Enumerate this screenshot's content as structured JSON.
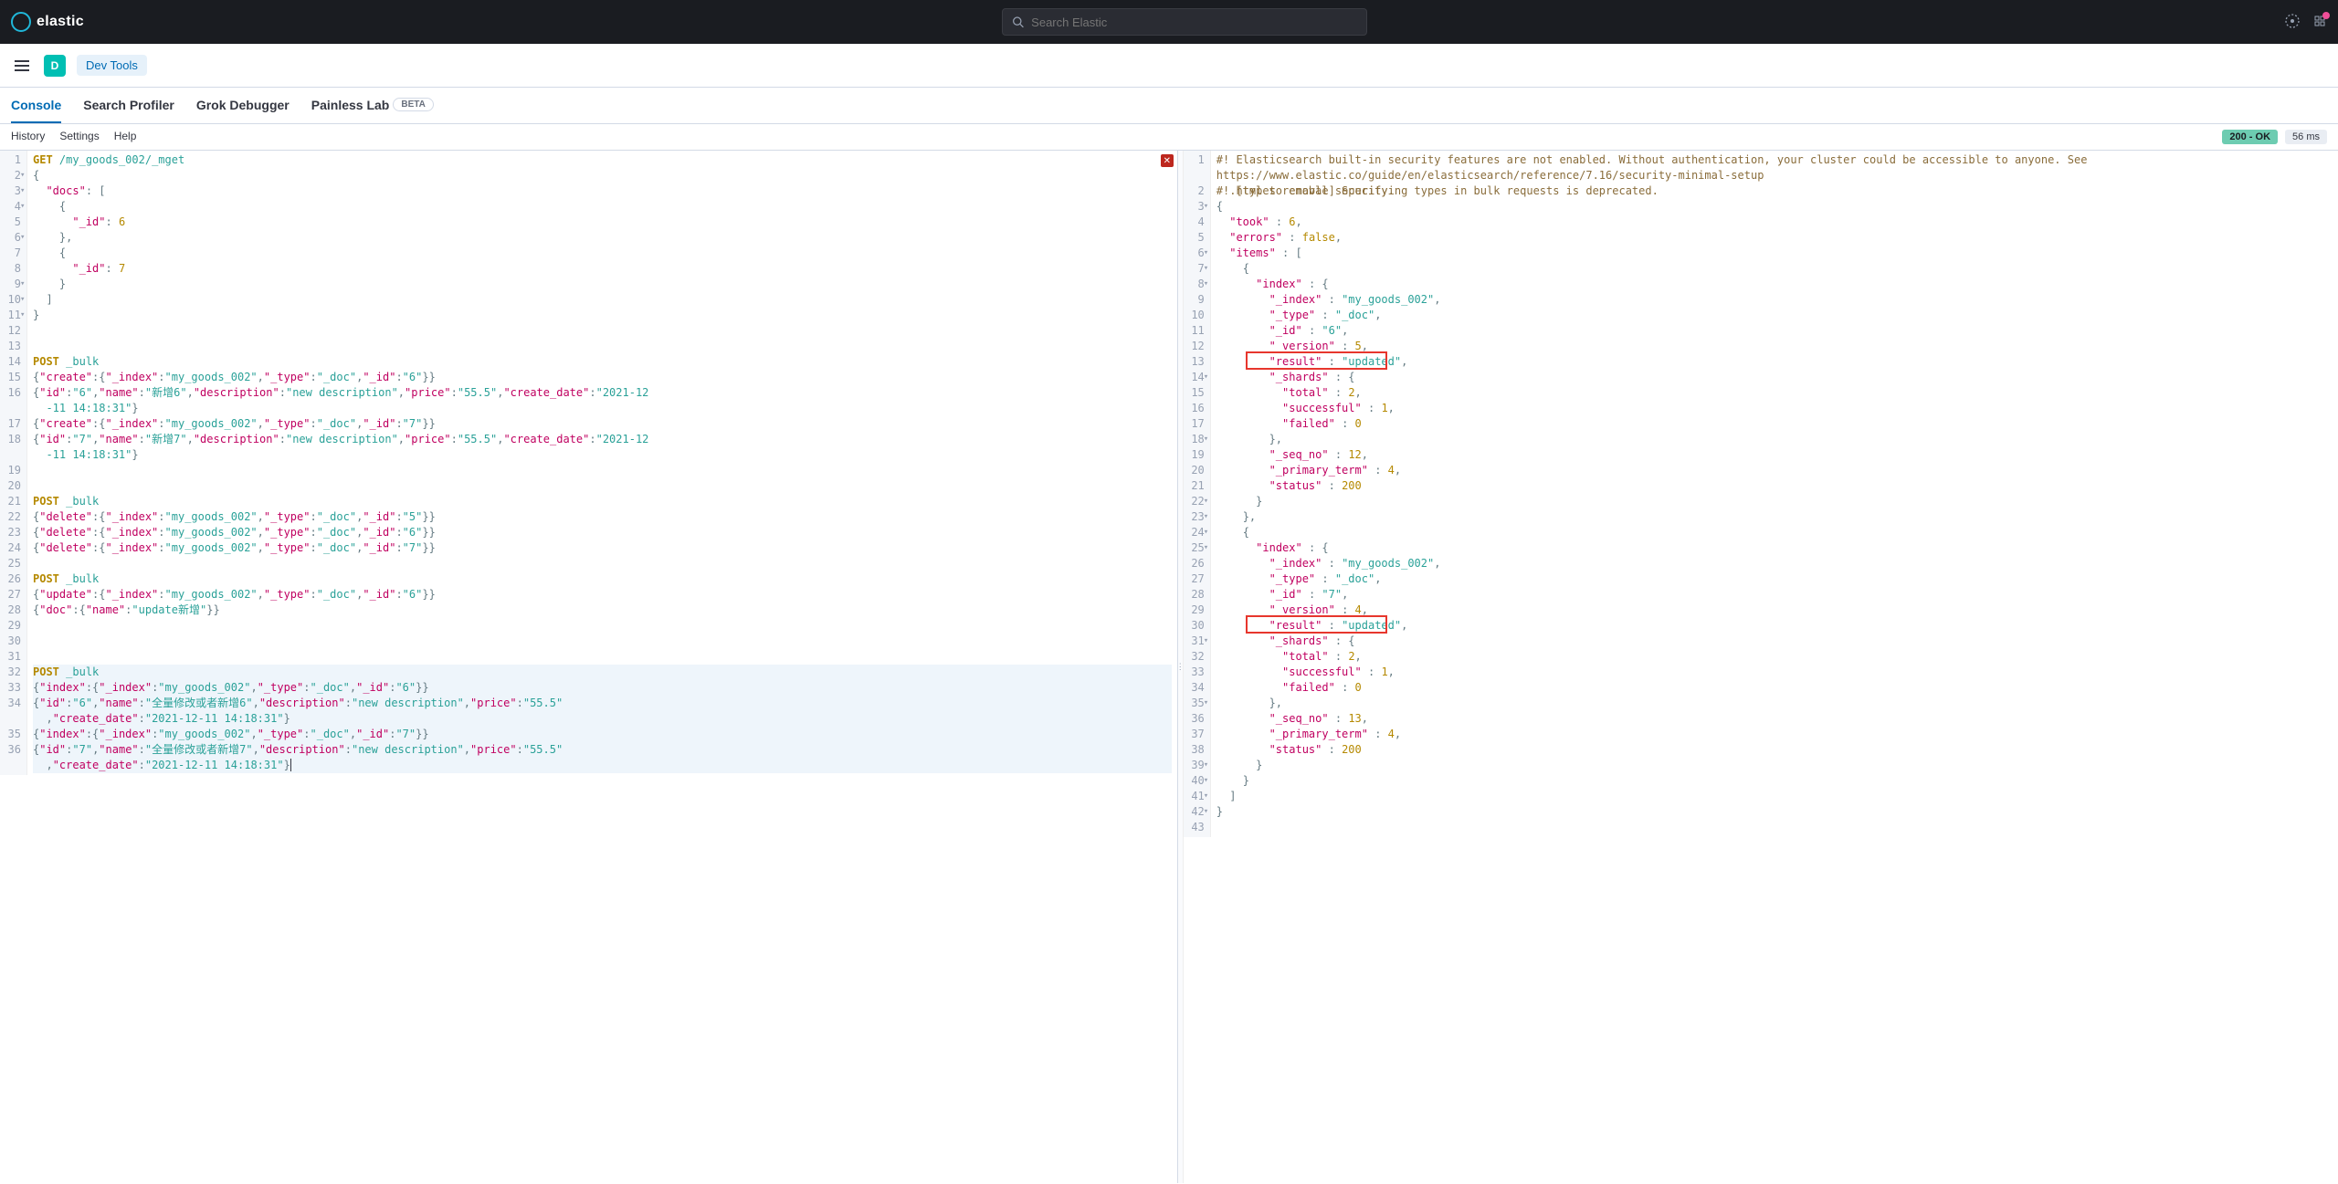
{
  "header": {
    "brand": "elastic",
    "search_placeholder": "Search Elastic",
    "space_initial": "D",
    "app_name": "Dev Tools"
  },
  "tabs": [
    {
      "label": "Console",
      "active": true
    },
    {
      "label": "Search Profiler"
    },
    {
      "label": "Grok Debugger"
    },
    {
      "label": "Painless Lab",
      "beta": "BETA"
    }
  ],
  "toolbar": {
    "history": "History",
    "settings": "Settings",
    "help": "Help",
    "status": "200 - OK",
    "time": "56 ms"
  },
  "request": {
    "lines": [
      {
        "n": 1,
        "html": "<span class='mtd'>GET</span> <span class='path'>/my_goods_002/_mget</span>"
      },
      {
        "n": 2,
        "fold": "▾",
        "html": "<span class='pun'>{</span>"
      },
      {
        "n": 3,
        "fold": "▾",
        "html": "  <span class='key'>\"docs\"</span><span class='pun'>: [</span>"
      },
      {
        "n": 4,
        "fold": "▾",
        "html": "    <span class='pun'>{</span>"
      },
      {
        "n": 5,
        "html": "      <span class='key'>\"_id\"</span><span class='pun'>:</span> <span class='num'>6</span>"
      },
      {
        "n": 6,
        "fold": "▾",
        "html": "    <span class='pun'>},</span>"
      },
      {
        "n": 7,
        "html": "    <span class='pun'>{</span>"
      },
      {
        "n": 8,
        "html": "      <span class='key'>\"_id\"</span><span class='pun'>:</span> <span class='num'>7</span>"
      },
      {
        "n": 9,
        "fold": "▾",
        "html": "    <span class='pun'>}</span>"
      },
      {
        "n": 10,
        "fold": "▾",
        "html": "  <span class='pun'>]</span>"
      },
      {
        "n": 11,
        "fold": "▾",
        "html": "<span class='pun'>}</span>"
      },
      {
        "n": 12,
        "html": ""
      },
      {
        "n": 13,
        "html": ""
      },
      {
        "n": 14,
        "html": "<span class='mtd'>POST</span> <span class='path'>_bulk</span>"
      },
      {
        "n": 15,
        "html": "<span class='pun'>{</span><span class='key'>\"create\"</span><span class='pun'>:{</span><span class='key'>\"_index\"</span><span class='pun'>:</span><span class='str'>\"my_goods_002\"</span><span class='pun'>,</span><span class='key'>\"_type\"</span><span class='pun'>:</span><span class='str'>\"_doc\"</span><span class='pun'>,</span><span class='key'>\"_id\"</span><span class='pun'>:</span><span class='str'>\"6\"</span><span class='pun'>}}</span>"
      },
      {
        "n": 16,
        "wrap": true,
        "html": "<span class='pun'>{</span><span class='key'>\"id\"</span><span class='pun'>:</span><span class='str'>\"6\"</span><span class='pun'>,</span><span class='key'>\"name\"</span><span class='pun'>:</span><span class='str'>\"新增6\"</span><span class='pun'>,</span><span class='key'>\"description\"</span><span class='pun'>:</span><span class='str'>\"new description\"</span><span class='pun'>,</span><span class='key'>\"price\"</span><span class='pun'>:</span><span class='str'>\"55.5\"</span><span class='pun'>,</span><span class='key'>\"create_date\"</span><span class='pun'>:</span><span class='str'>\"2021-12\n  -11 14:18:31\"</span><span class='pun'>}</span>"
      },
      {
        "n": 17,
        "html": "<span class='pun'>{</span><span class='key'>\"create\"</span><span class='pun'>:{</span><span class='key'>\"_index\"</span><span class='pun'>:</span><span class='str'>\"my_goods_002\"</span><span class='pun'>,</span><span class='key'>\"_type\"</span><span class='pun'>:</span><span class='str'>\"_doc\"</span><span class='pun'>,</span><span class='key'>\"_id\"</span><span class='pun'>:</span><span class='str'>\"7\"</span><span class='pun'>}}</span>"
      },
      {
        "n": 18,
        "wrap": true,
        "html": "<span class='pun'>{</span><span class='key'>\"id\"</span><span class='pun'>:</span><span class='str'>\"7\"</span><span class='pun'>,</span><span class='key'>\"name\"</span><span class='pun'>:</span><span class='str'>\"新增7\"</span><span class='pun'>,</span><span class='key'>\"description\"</span><span class='pun'>:</span><span class='str'>\"new description\"</span><span class='pun'>,</span><span class='key'>\"price\"</span><span class='pun'>:</span><span class='str'>\"55.5\"</span><span class='pun'>,</span><span class='key'>\"create_date\"</span><span class='pun'>:</span><span class='str'>\"2021-12\n  -11 14:18:31\"</span><span class='pun'>}</span>"
      },
      {
        "n": 19,
        "html": ""
      },
      {
        "n": 20,
        "html": ""
      },
      {
        "n": 21,
        "html": "<span class='mtd'>POST</span> <span class='path'>_bulk</span>"
      },
      {
        "n": 22,
        "html": "<span class='pun'>{</span><span class='key'>\"delete\"</span><span class='pun'>:{</span><span class='key'>\"_index\"</span><span class='pun'>:</span><span class='str'>\"my_goods_002\"</span><span class='pun'>,</span><span class='key'>\"_type\"</span><span class='pun'>:</span><span class='str'>\"_doc\"</span><span class='pun'>,</span><span class='key'>\"_id\"</span><span class='pun'>:</span><span class='str'>\"5\"</span><span class='pun'>}}</span>"
      },
      {
        "n": 23,
        "html": "<span class='pun'>{</span><span class='key'>\"delete\"</span><span class='pun'>:{</span><span class='key'>\"_index\"</span><span class='pun'>:</span><span class='str'>\"my_goods_002\"</span><span class='pun'>,</span><span class='key'>\"_type\"</span><span class='pun'>:</span><span class='str'>\"_doc\"</span><span class='pun'>,</span><span class='key'>\"_id\"</span><span class='pun'>:</span><span class='str'>\"6\"</span><span class='pun'>}}</span>"
      },
      {
        "n": 24,
        "html": "<span class='pun'>{</span><span class='key'>\"delete\"</span><span class='pun'>:{</span><span class='key'>\"_index\"</span><span class='pun'>:</span><span class='str'>\"my_goods_002\"</span><span class='pun'>,</span><span class='key'>\"_type\"</span><span class='pun'>:</span><span class='str'>\"_doc\"</span><span class='pun'>,</span><span class='key'>\"_id\"</span><span class='pun'>:</span><span class='str'>\"7\"</span><span class='pun'>}}</span>"
      },
      {
        "n": 25,
        "html": ""
      },
      {
        "n": 26,
        "html": "<span class='mtd'>POST</span> <span class='path'>_bulk</span>"
      },
      {
        "n": 27,
        "html": "<span class='pun'>{</span><span class='key'>\"update\"</span><span class='pun'>:{</span><span class='key'>\"_index\"</span><span class='pun'>:</span><span class='str'>\"my_goods_002\"</span><span class='pun'>,</span><span class='key'>\"_type\"</span><span class='pun'>:</span><span class='str'>\"_doc\"</span><span class='pun'>,</span><span class='key'>\"_id\"</span><span class='pun'>:</span><span class='str'>\"6\"</span><span class='pun'>}}</span>"
      },
      {
        "n": 28,
        "html": "<span class='pun'>{</span><span class='key'>\"doc\"</span><span class='pun'>:{</span><span class='key'>\"name\"</span><span class='pun'>:</span><span class='str'>\"update新增\"</span><span class='pun'>}}</span>"
      },
      {
        "n": 29,
        "html": ""
      },
      {
        "n": 30,
        "html": ""
      },
      {
        "n": 31,
        "html": ""
      },
      {
        "n": 32,
        "sel": true,
        "run": true,
        "html": "<span class='mtd'>POST</span> <span class='path'>_bulk</span>"
      },
      {
        "n": 33,
        "sel": true,
        "html": "<span class='pun'>{</span><span class='key'>\"index\"</span><span class='pun'>:{</span><span class='key'>\"_index\"</span><span class='pun'>:</span><span class='str'>\"my_goods_002\"</span><span class='pun'>,</span><span class='key'>\"_type\"</span><span class='pun'>:</span><span class='str'>\"_doc\"</span><span class='pun'>,</span><span class='key'>\"_id\"</span><span class='pun'>:</span><span class='str'>\"6\"</span><span class='pun'>}}</span>"
      },
      {
        "n": 34,
        "sel": true,
        "wrap": true,
        "html": "<span class='pun'>{</span><span class='key'>\"id\"</span><span class='pun'>:</span><span class='str'>\"6\"</span><span class='pun'>,</span><span class='key'>\"name\"</span><span class='pun'>:</span><span class='str'>\"全量修改或者新增6\"</span><span class='pun'>,</span><span class='key'>\"description\"</span><span class='pun'>:</span><span class='str'>\"new description\"</span><span class='pun'>,</span><span class='key'>\"price\"</span><span class='pun'>:</span><span class='str'>\"55.5\"</span>\n  <span class='pun'>,</span><span class='key'>\"create_date\"</span><span class='pun'>:</span><span class='str'>\"2021-12-11 14:18:31\"</span><span class='pun'>}</span>"
      },
      {
        "n": 35,
        "sel": true,
        "html": "<span class='pun'>{</span><span class='key'>\"index\"</span><span class='pun'>:{</span><span class='key'>\"_index\"</span><span class='pun'>:</span><span class='str'>\"my_goods_002\"</span><span class='pun'>,</span><span class='key'>\"_type\"</span><span class='pun'>:</span><span class='str'>\"_doc\"</span><span class='pun'>,</span><span class='key'>\"_id\"</span><span class='pun'>:</span><span class='str'>\"7\"</span><span class='pun'>}}</span>"
      },
      {
        "n": 36,
        "sel": true,
        "wrap": true,
        "html": "<span class='pun'>{</span><span class='key'>\"id\"</span><span class='pun'>:</span><span class='str'>\"7\"</span><span class='pun'>,</span><span class='key'>\"name\"</span><span class='pun'>:</span><span class='str'>\"全量修改或者新增7\"</span><span class='pun'>,</span><span class='key'>\"description\"</span><span class='pun'>:</span><span class='str'>\"new description\"</span><span class='pun'>,</span><span class='key'>\"price\"</span><span class='pun'>:</span><span class='str'>\"55.5\"</span>\n  <span class='pun'>,</span><span class='key'>\"create_date\"</span><span class='pun'>:</span><span class='str'>\"2021-12-11 14:18:31\"</span><span class='pun'>}</span><span style='border-left:1px solid #343741'></span>"
      }
    ]
  },
  "response": {
    "lines": [
      {
        "n": 1,
        "wrap": true,
        "html": "<span class='warn'>#! Elasticsearch built-in security features are not enabled. Without authentication, your cluster could be accessible to anyone. See https://www.elastic.co/guide/en/elasticsearch/reference/7.16/security-minimal-setup\n  .html to enable security.</span>"
      },
      {
        "n": 2,
        "html": "<span class='warn'>#! [types removal] Specifying types in bulk requests is deprecated.</span>"
      },
      {
        "n": 3,
        "fold": "▾",
        "html": "<span class='pun'>{</span>"
      },
      {
        "n": 4,
        "html": "  <span class='key'>\"took\"</span> <span class='pun'>:</span> <span class='num'>6</span><span class='pun'>,</span>"
      },
      {
        "n": 5,
        "html": "  <span class='key'>\"errors\"</span> <span class='pun'>:</span> <span class='bool'>false</span><span class='pun'>,</span>"
      },
      {
        "n": 6,
        "fold": "▾",
        "html": "  <span class='key'>\"items\"</span> <span class='pun'>: [</span>"
      },
      {
        "n": 7,
        "fold": "▾",
        "html": "    <span class='pun'>{</span>"
      },
      {
        "n": 8,
        "fold": "▾",
        "html": "      <span class='key'>\"index\"</span> <span class='pun'>: {</span>"
      },
      {
        "n": 9,
        "html": "        <span class='key'>\"_index\"</span> <span class='pun'>:</span> <span class='str'>\"my_goods_002\"</span><span class='pun'>,</span>"
      },
      {
        "n": 10,
        "html": "        <span class='key'>\"_type\"</span> <span class='pun'>:</span> <span class='str'>\"_doc\"</span><span class='pun'>,</span>"
      },
      {
        "n": 11,
        "html": "        <span class='key'>\"_id\"</span> <span class='pun'>:</span> <span class='str'>\"6\"</span><span class='pun'>,</span>"
      },
      {
        "n": 12,
        "html": "        <span class='key'>\"_version\"</span> <span class='pun'>:</span> <span class='num'>5</span><span class='pun'>,</span>"
      },
      {
        "n": 13,
        "box": true,
        "html": "        <span class='key'>\"result\"</span> <span class='pun'>:</span> <span class='str'>\"updated\"</span><span class='pun'>,</span>"
      },
      {
        "n": 14,
        "fold": "▾",
        "html": "        <span class='key'>\"_shards\"</span> <span class='pun'>: {</span>"
      },
      {
        "n": 15,
        "html": "          <span class='key'>\"total\"</span> <span class='pun'>:</span> <span class='num'>2</span><span class='pun'>,</span>"
      },
      {
        "n": 16,
        "html": "          <span class='key'>\"successful\"</span> <span class='pun'>:</span> <span class='num'>1</span><span class='pun'>,</span>"
      },
      {
        "n": 17,
        "html": "          <span class='key'>\"failed\"</span> <span class='pun'>:</span> <span class='num'>0</span>"
      },
      {
        "n": 18,
        "fold": "▾",
        "html": "        <span class='pun'>},</span>"
      },
      {
        "n": 19,
        "html": "        <span class='key'>\"_seq_no\"</span> <span class='pun'>:</span> <span class='num'>12</span><span class='pun'>,</span>"
      },
      {
        "n": 20,
        "html": "        <span class='key'>\"_primary_term\"</span> <span class='pun'>:</span> <span class='num'>4</span><span class='pun'>,</span>"
      },
      {
        "n": 21,
        "html": "        <span class='key'>\"status\"</span> <span class='pun'>:</span> <span class='num'>200</span>"
      },
      {
        "n": 22,
        "fold": "▾",
        "html": "      <span class='pun'>}</span>"
      },
      {
        "n": 23,
        "fold": "▾",
        "html": "    <span class='pun'>},</span>"
      },
      {
        "n": 24,
        "fold": "▾",
        "html": "    <span class='pun'>{</span>"
      },
      {
        "n": 25,
        "fold": "▾",
        "html": "      <span class='key'>\"index\"</span> <span class='pun'>: {</span>"
      },
      {
        "n": 26,
        "html": "        <span class='key'>\"_index\"</span> <span class='pun'>:</span> <span class='str'>\"my_goods_002\"</span><span class='pun'>,</span>"
      },
      {
        "n": 27,
        "html": "        <span class='key'>\"_type\"</span> <span class='pun'>:</span> <span class='str'>\"_doc\"</span><span class='pun'>,</span>"
      },
      {
        "n": 28,
        "html": "        <span class='key'>\"_id\"</span> <span class='pun'>:</span> <span class='str'>\"7\"</span><span class='pun'>,</span>"
      },
      {
        "n": 29,
        "html": "        <span class='key'>\"_version\"</span> <span class='pun'>:</span> <span class='num'>4</span><span class='pun'>,</span>"
      },
      {
        "n": 30,
        "box": true,
        "html": "        <span class='key'>\"result\"</span> <span class='pun'>:</span> <span class='str'>\"updated\"</span><span class='pun'>,</span>"
      },
      {
        "n": 31,
        "fold": "▾",
        "html": "        <span class='key'>\"_shards\"</span> <span class='pun'>: {</span>"
      },
      {
        "n": 32,
        "html": "          <span class='key'>\"total\"</span> <span class='pun'>:</span> <span class='num'>2</span><span class='pun'>,</span>"
      },
      {
        "n": 33,
        "html": "          <span class='key'>\"successful\"</span> <span class='pun'>:</span> <span class='num'>1</span><span class='pun'>,</span>"
      },
      {
        "n": 34,
        "html": "          <span class='key'>\"failed\"</span> <span class='pun'>:</span> <span class='num'>0</span>"
      },
      {
        "n": 35,
        "fold": "▾",
        "html": "        <span class='pun'>},</span>"
      },
      {
        "n": 36,
        "html": "        <span class='key'>\"_seq_no\"</span> <span class='pun'>:</span> <span class='num'>13</span><span class='pun'>,</span>"
      },
      {
        "n": 37,
        "html": "        <span class='key'>\"_primary_term\"</span> <span class='pun'>:</span> <span class='num'>4</span><span class='pun'>,</span>"
      },
      {
        "n": 38,
        "html": "        <span class='key'>\"status\"</span> <span class='pun'>:</span> <span class='num'>200</span>"
      },
      {
        "n": 39,
        "fold": "▾",
        "html": "      <span class='pun'>}</span>"
      },
      {
        "n": 40,
        "fold": "▾",
        "html": "    <span class='pun'>}</span>"
      },
      {
        "n": 41,
        "fold": "▾",
        "html": "  <span class='pun'>]</span>"
      },
      {
        "n": 42,
        "fold": "▾",
        "html": "<span class='pun'>}</span>"
      },
      {
        "n": 43,
        "html": ""
      }
    ]
  }
}
